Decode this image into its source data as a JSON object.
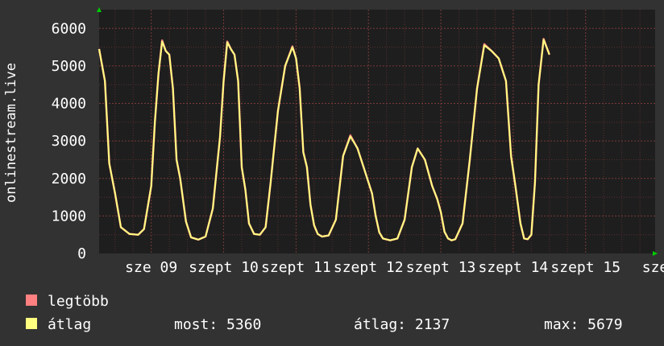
{
  "chart_data": {
    "type": "line",
    "ylabel": "onlinestream.live",
    "ylim": [
      0,
      6500
    ],
    "yticks": [
      0,
      1000,
      2000,
      3000,
      4000,
      5000,
      6000
    ],
    "xlim": [
      -0.72,
      6.96
    ],
    "xticks": [
      {
        "pos": 0,
        "label": "sze 09"
      },
      {
        "pos": 1,
        "label": "szept 10"
      },
      {
        "pos": 2,
        "label": "szept 11"
      },
      {
        "pos": 3,
        "label": "szept 12"
      },
      {
        "pos": 4,
        "label": "szept 13"
      },
      {
        "pos": 5,
        "label": "szept 14"
      },
      {
        "pos": 6,
        "label": "szept 15"
      },
      {
        "pos": 6.96,
        "label": "sze"
      }
    ],
    "x": [
      -0.72,
      -0.64,
      -0.58,
      -0.5,
      -0.42,
      -0.3,
      -0.18,
      -0.1,
      0.0,
      0.05,
      0.1,
      0.15,
      0.2,
      0.25,
      0.3,
      0.35,
      0.4,
      0.48,
      0.55,
      0.65,
      0.75,
      0.85,
      0.95,
      1.0,
      1.05,
      1.1,
      1.15,
      1.2,
      1.25,
      1.3,
      1.35,
      1.42,
      1.5,
      1.58,
      1.65,
      1.75,
      1.85,
      1.95,
      2.0,
      2.05,
      2.1,
      2.15,
      2.2,
      2.25,
      2.3,
      2.36,
      2.45,
      2.55,
      2.65,
      2.75,
      2.85,
      2.95,
      3.0,
      3.05,
      3.1,
      3.15,
      3.2,
      3.3,
      3.4,
      3.5,
      3.6,
      3.68,
      3.78,
      3.88,
      3.95,
      4.0,
      4.05,
      4.1,
      4.15,
      4.2,
      4.3,
      4.4,
      4.5,
      4.6,
      4.7,
      4.8,
      4.9,
      4.97,
      5.03,
      5.1,
      5.15,
      5.2,
      5.25,
      5.3,
      5.35,
      5.42,
      5.5,
      5.6,
      5.7,
      5.8,
      5.88,
      5.95,
      6.0,
      6.05,
      6.1,
      6.15,
      6.2,
      6.25,
      6.32
    ],
    "series": [
      {
        "name": "legtöbb",
        "color": "#ff8080",
        "values": [
          5450,
          4600,
          2400,
          1600,
          700,
          520,
          500,
          650,
          1800,
          3500,
          4800,
          5680,
          5400,
          5300,
          4400,
          2500,
          2000,
          850,
          430,
          370,
          450,
          1200,
          3100,
          4600,
          5650,
          5450,
          5300,
          4600,
          2300,
          1700,
          800,
          520,
          500,
          700,
          1900,
          3800,
          5000,
          5520,
          5200,
          4400,
          2700,
          2300,
          1300,
          750,
          520,
          450,
          480,
          900,
          2600,
          3150,
          2800,
          2200,
          1900,
          1600,
          1000,
          560,
          400,
          350,
          400,
          900,
          2300,
          2800,
          2500,
          1800,
          1450,
          1100,
          580,
          400,
          350,
          380,
          800,
          2500,
          4400,
          5580,
          5400,
          5200,
          4600,
          2600,
          1800,
          800,
          400,
          380,
          500,
          1900,
          4500,
          5720,
          5300
        ]
      },
      {
        "name": "átlag",
        "color": "#ffff80",
        "values": [
          5450,
          4600,
          2400,
          1600,
          700,
          520,
          500,
          650,
          1800,
          3500,
          4800,
          5650,
          5400,
          5300,
          4400,
          2500,
          2000,
          850,
          430,
          370,
          450,
          1200,
          3100,
          4600,
          5630,
          5450,
          5300,
          4600,
          2300,
          1700,
          800,
          520,
          500,
          700,
          1900,
          3800,
          5000,
          5500,
          5200,
          4400,
          2700,
          2300,
          1300,
          750,
          520,
          450,
          480,
          900,
          2600,
          3120,
          2800,
          2200,
          1900,
          1600,
          1000,
          560,
          400,
          350,
          400,
          900,
          2300,
          2800,
          2500,
          1800,
          1450,
          1100,
          580,
          400,
          350,
          380,
          800,
          2500,
          4400,
          5550,
          5400,
          5200,
          4600,
          2600,
          1800,
          800,
          400,
          380,
          500,
          1900,
          4500,
          5700,
          5300
        ]
      }
    ],
    "grid": true,
    "legend_position": "bottom-left",
    "stats": {
      "most": "most: 5360",
      "atlag": "átlag: 2137",
      "max": "max: 5679"
    },
    "colors": {
      "background": "#323232",
      "plot_background": "#1e1e1e",
      "grid": "#5a2e2e",
      "axis_arrow": "#00cc00",
      "text": "#ffffff"
    }
  }
}
